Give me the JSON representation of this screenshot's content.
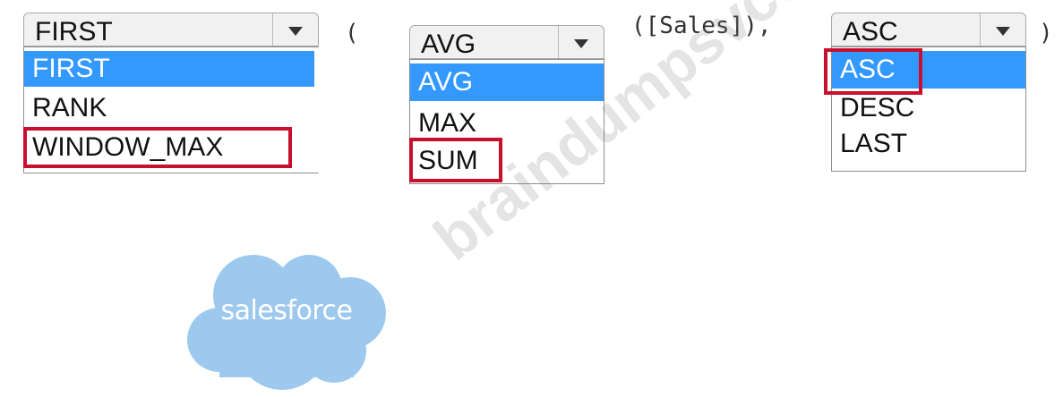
{
  "formula": {
    "open_paren": "(",
    "field_expression": "([Sales]),",
    "close_paren": ")"
  },
  "dropdowns": [
    {
      "selected_value": "FIRST",
      "options": [
        {
          "label": "FIRST",
          "highlighted": true
        },
        {
          "label": "RANK",
          "highlighted": false
        },
        {
          "label": "WINDOW_MAX",
          "highlighted": false
        }
      ],
      "answer": "WINDOW_MAX"
    },
    {
      "selected_value": "AVG",
      "options": [
        {
          "label": "AVG",
          "highlighted": true
        },
        {
          "label": "MAX",
          "highlighted": false
        },
        {
          "label": "SUM",
          "highlighted": false
        }
      ],
      "answer": "SUM"
    },
    {
      "selected_value": "ASC",
      "options": [
        {
          "label": "ASC",
          "highlighted": true
        },
        {
          "label": "DESC",
          "highlighted": false
        },
        {
          "label": "LAST",
          "highlighted": false
        }
      ],
      "answer": "ASC"
    }
  ],
  "logo": {
    "text": "salesforce",
    "color": "#9ec9ee"
  },
  "watermark": "braindumpsvce.com",
  "colors": {
    "selection": "#3399ff",
    "answer_box": "#c8102e",
    "header_bg": "#f1f1f1"
  }
}
